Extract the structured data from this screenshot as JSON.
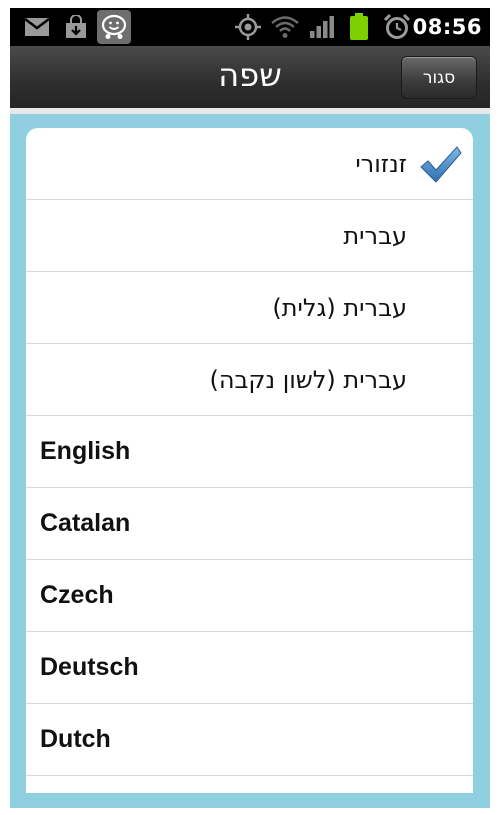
{
  "status_bar": {
    "time": "08:56",
    "icons": [
      "gmail-icon",
      "download-icon",
      "waze-icon",
      "gps-icon",
      "wifi-icon",
      "signal-icon",
      "battery-icon",
      "alarm-icon"
    ]
  },
  "header": {
    "title": "שפה",
    "close_label": "סגור"
  },
  "languages": [
    {
      "label": "זנזורי",
      "selected": true,
      "dir": "rtl"
    },
    {
      "label": "עברית",
      "selected": false,
      "dir": "rtl"
    },
    {
      "label": "עברית (גלית)",
      "selected": false,
      "dir": "rtl"
    },
    {
      "label": "עברית (לשון נקבה)",
      "selected": false,
      "dir": "rtl"
    },
    {
      "label": "English",
      "selected": false,
      "dir": "ltr"
    },
    {
      "label": "Catalan",
      "selected": false,
      "dir": "ltr"
    },
    {
      "label": "Czech",
      "selected": false,
      "dir": "ltr"
    },
    {
      "label": "Deutsch",
      "selected": false,
      "dir": "ltr"
    },
    {
      "label": "Dutch",
      "selected": false,
      "dir": "ltr"
    }
  ],
  "colors": {
    "accent_blue": "#8fcfe0",
    "check_blue": "#3c7fc0",
    "battery_green": "#7fd000"
  }
}
